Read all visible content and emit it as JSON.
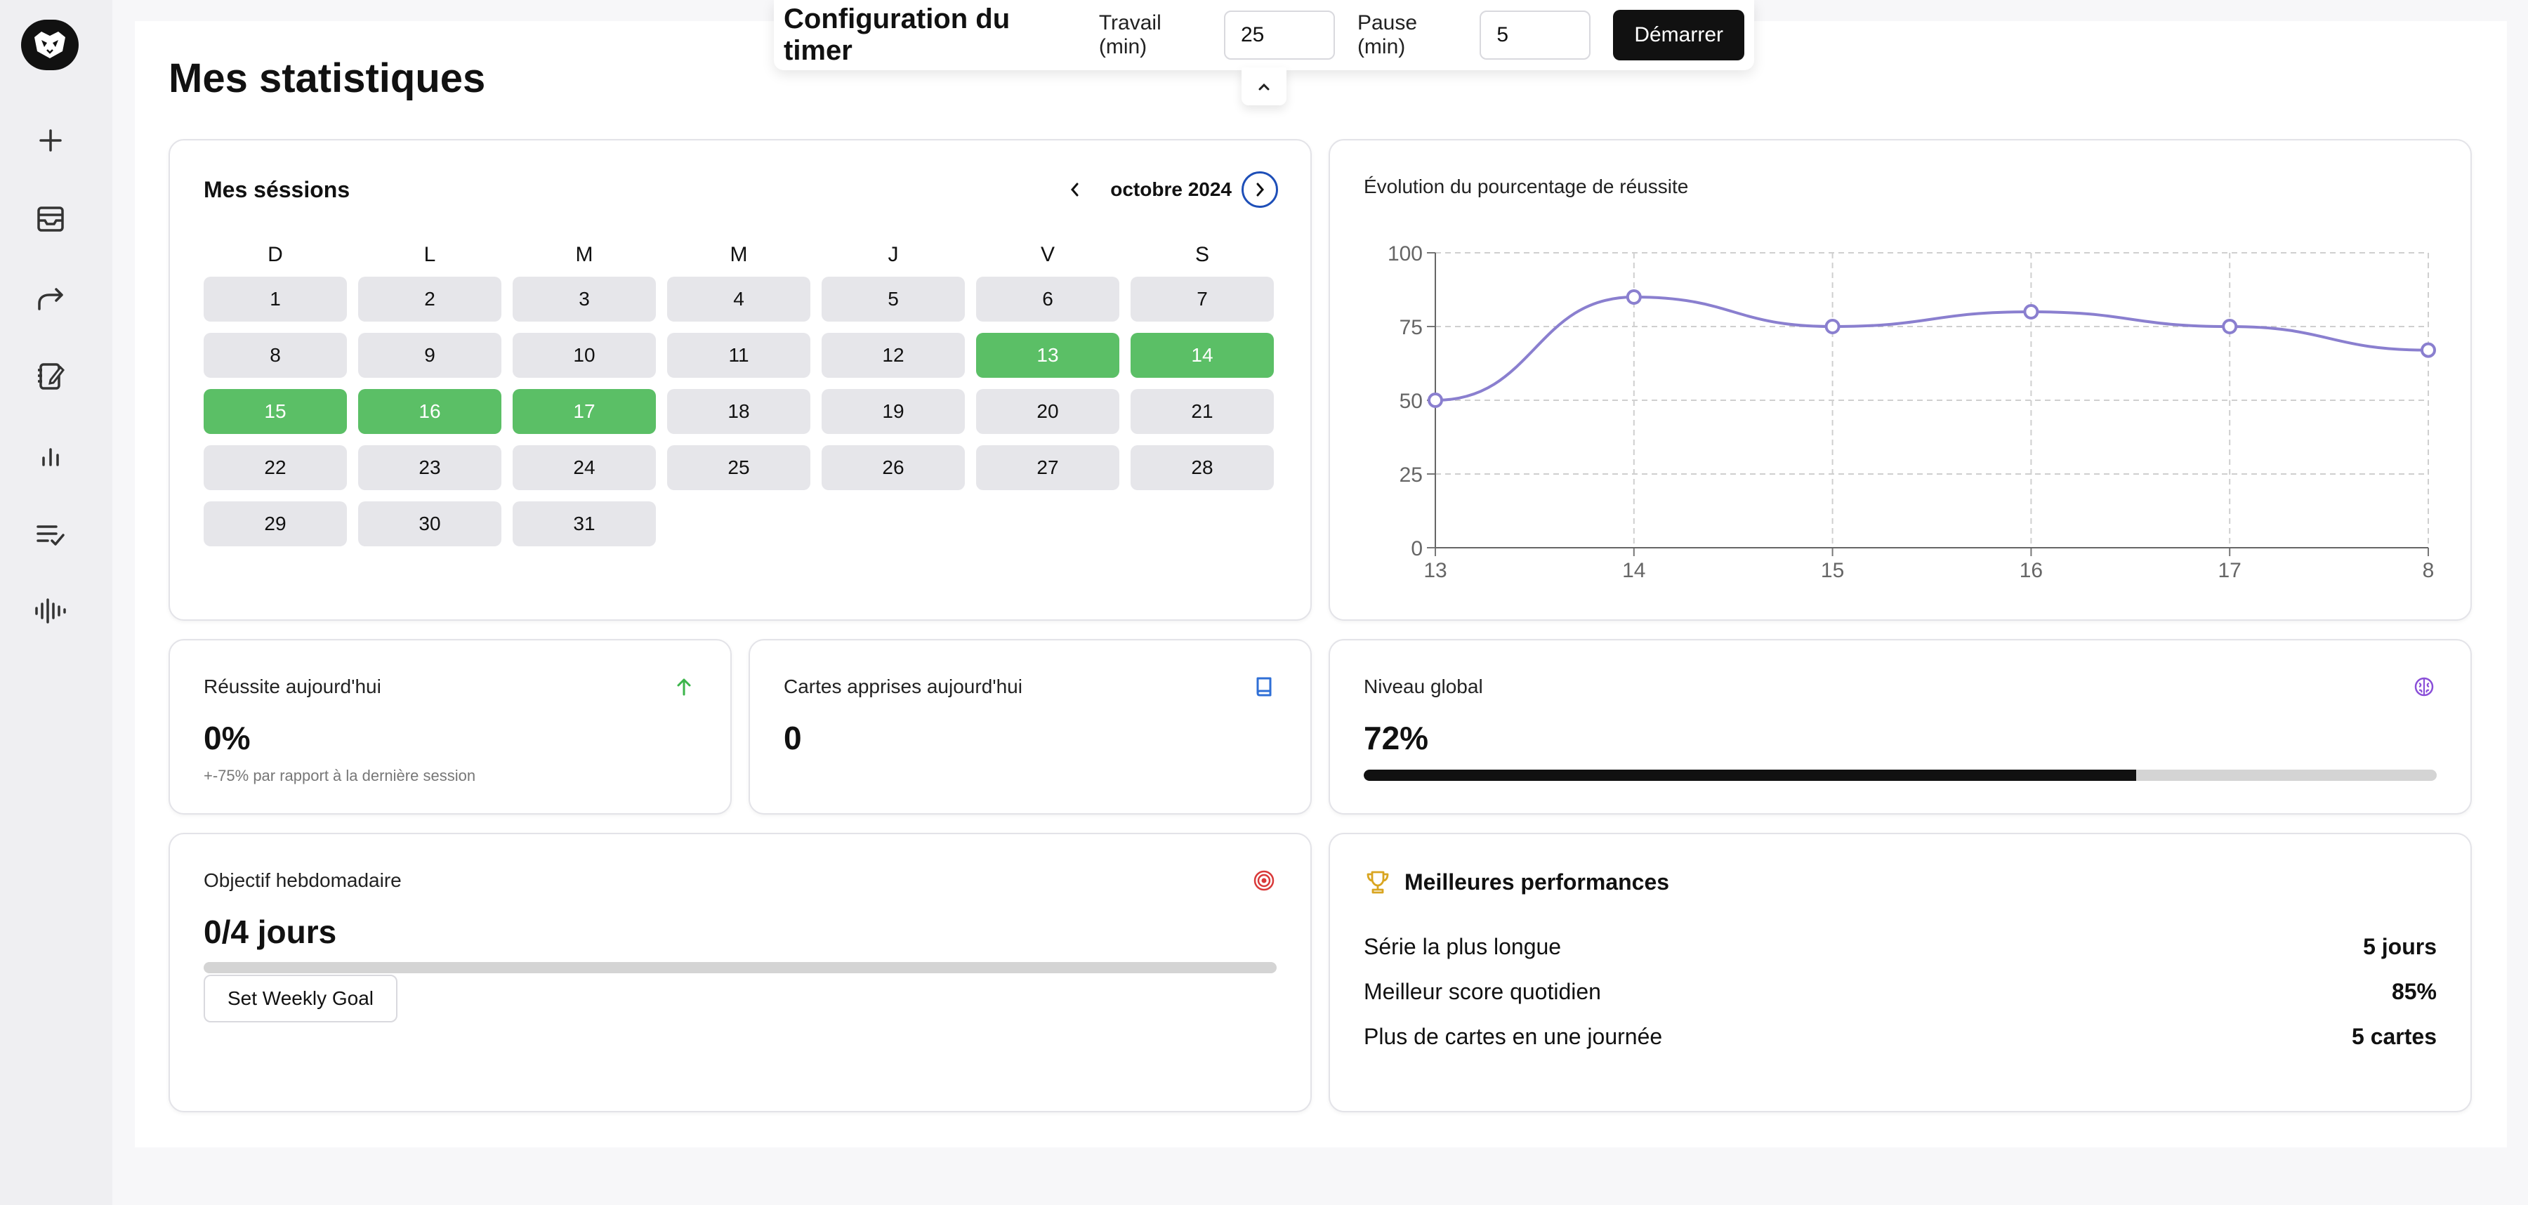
{
  "timer": {
    "title": "Configuration du timer",
    "work_label": "Travail (min)",
    "work_value": "25",
    "pause_label": "Pause (min)",
    "pause_value": "5",
    "start_label": "Démarrer"
  },
  "page": {
    "title": "Mes statistiques"
  },
  "calendar": {
    "title": "Mes séssions",
    "month": "octobre 2024",
    "weekdays": [
      "D",
      "L",
      "M",
      "M",
      "J",
      "V",
      "S"
    ],
    "days": 31,
    "active_days": [
      13,
      14,
      15,
      16,
      17
    ],
    "active_color": "#5bbf66"
  },
  "chart": {
    "title": "Évolution du pourcentage de réussite"
  },
  "chart_data": {
    "type": "line",
    "title": "Évolution du pourcentage de réussite",
    "x": [
      "13",
      "14",
      "15",
      "16",
      "17",
      "8"
    ],
    "series": [
      {
        "values": [
          50,
          85,
          75,
          80,
          75,
          67
        ]
      }
    ],
    "yticks": [
      "0",
      "25",
      "50",
      "75",
      "100"
    ],
    "ylim": [
      0,
      100
    ],
    "grid": true,
    "line_color": "#8a7fcf"
  },
  "stats": {
    "success_today": {
      "label": "Réussite aujourd'hui",
      "value": "0%",
      "sub": "+-75% par rapport à la dernière session",
      "icon": "arrow-up-icon",
      "icon_color": "#3bb54a"
    },
    "cards_today": {
      "label": "Cartes apprises aujourd'hui",
      "value": "0",
      "icon": "book-icon",
      "icon_color": "#2f6fd6"
    },
    "global_level": {
      "label": "Niveau global",
      "value": "72%",
      "progress": 0.72,
      "icon": "brain-icon",
      "icon_color": "#8a4fd8"
    },
    "weekly_goal": {
      "label": "Objectif hebdomadaire",
      "value": "0/4 jours",
      "progress": 0,
      "button": "Set Weekly Goal",
      "icon": "target-icon",
      "icon_color": "#d93a3a"
    }
  },
  "performances": {
    "title": "Meilleures performances",
    "icon": "trophy-icon",
    "icon_color": "#d9a520",
    "rows": [
      {
        "label": "Série la plus longue",
        "value": "5 jours"
      },
      {
        "label": "Meilleur score quotidien",
        "value": "85%"
      },
      {
        "label": "Plus de cartes en une journée",
        "value": "5 cartes"
      }
    ]
  },
  "sidebar": {
    "icons": [
      "logo-icon",
      "plus-icon",
      "inbox-icon",
      "share-forward-icon",
      "notebook-edit-icon",
      "bar-chart-icon",
      "checklist-icon",
      "audio-wave-icon"
    ]
  }
}
